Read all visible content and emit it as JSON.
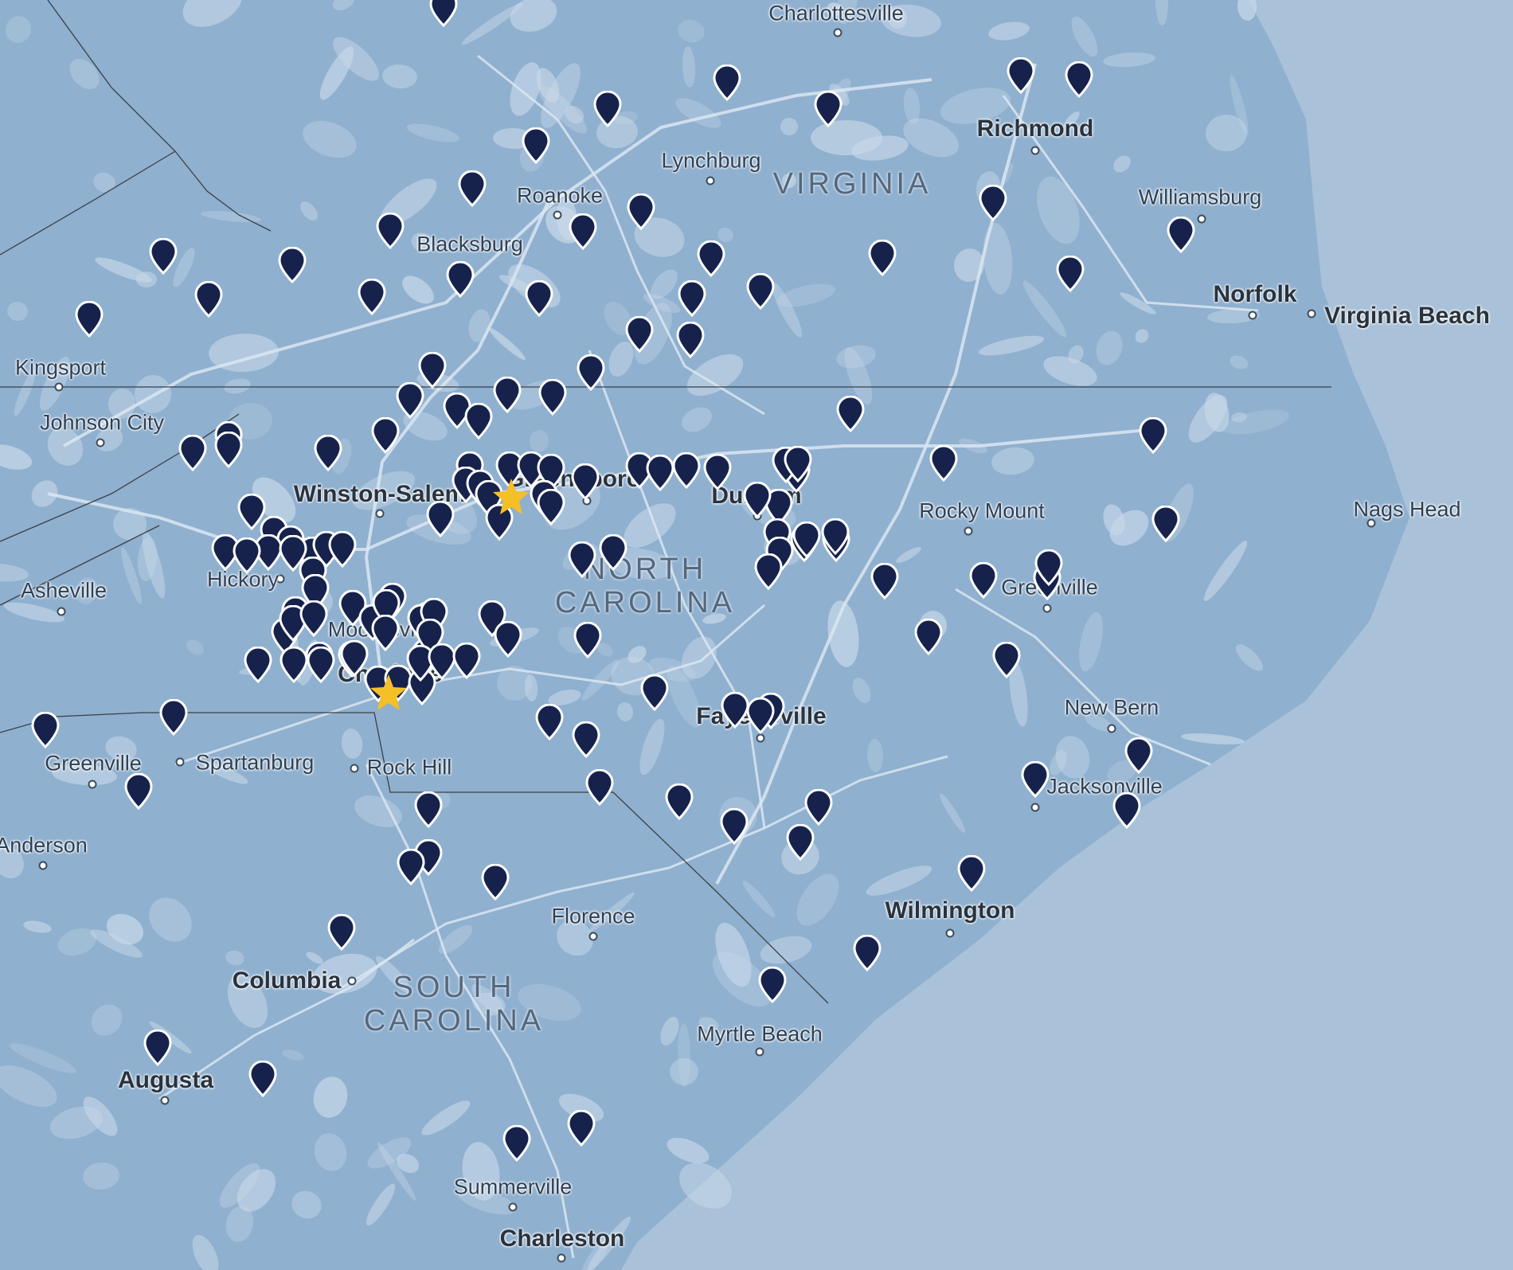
{
  "colors": {
    "land": "#8fb0cf",
    "land_light": "#c9d9e9",
    "water": "#a9c2d9",
    "road": "#dbe6f1",
    "border": "#3b3f45",
    "pin": "#16224b",
    "pin_outline": "#ffffff",
    "star": "#f5bf27"
  },
  "map": {
    "states": [
      {
        "name": "VIRGINIA",
        "lines": [
          "VIRGINIA"
        ]
      },
      {
        "name": "NORTH CAROLINA",
        "lines": [
          "NORTH",
          "CAROLINA"
        ]
      },
      {
        "name": "SOUTH CAROLINA",
        "lines": [
          "SOUTH",
          "CAROLINA"
        ]
      }
    ],
    "cities": [
      {
        "name": "Charlottesville",
        "major": false
      },
      {
        "name": "Richmond",
        "major": true
      },
      {
        "name": "Lynchburg",
        "major": false
      },
      {
        "name": "Roanoke",
        "major": false
      },
      {
        "name": "Blacksburg",
        "major": false
      },
      {
        "name": "Williamsburg",
        "major": false
      },
      {
        "name": "Norfolk",
        "major": true
      },
      {
        "name": "Virginia Beach",
        "major": true
      },
      {
        "name": "Kingsport",
        "major": false
      },
      {
        "name": "Johnson City",
        "major": false
      },
      {
        "name": "Winston-Salem",
        "major": true
      },
      {
        "name": "Greensboro",
        "major": true
      },
      {
        "name": "Durham",
        "major": true
      },
      {
        "name": "Rocky Mount",
        "major": false
      },
      {
        "name": "Nags Head",
        "major": false
      },
      {
        "name": "Hickory",
        "major": false
      },
      {
        "name": "Asheville",
        "major": false
      },
      {
        "name": "Greenville",
        "major": false
      },
      {
        "name": "Mooresville",
        "major": false
      },
      {
        "name": "Charlotte",
        "major": true
      },
      {
        "name": "Fayetteville",
        "major": true
      },
      {
        "name": "New Bern",
        "major": false
      },
      {
        "name": "Greenville",
        "major": false
      },
      {
        "name": "Spartanburg",
        "major": false
      },
      {
        "name": "Rock Hill",
        "major": false
      },
      {
        "name": "Jacksonville",
        "major": false
      },
      {
        "name": "Anderson",
        "major": false
      },
      {
        "name": "Florence",
        "major": false
      },
      {
        "name": "Wilmington",
        "major": true
      },
      {
        "name": "Columbia",
        "major": true
      },
      {
        "name": "Myrtle Beach",
        "major": false
      },
      {
        "name": "Augusta",
        "major": true
      },
      {
        "name": "Summerville",
        "major": false
      },
      {
        "name": "Charleston",
        "major": true
      }
    ],
    "location_marker_count": 150,
    "featured_marker_count": 2
  }
}
